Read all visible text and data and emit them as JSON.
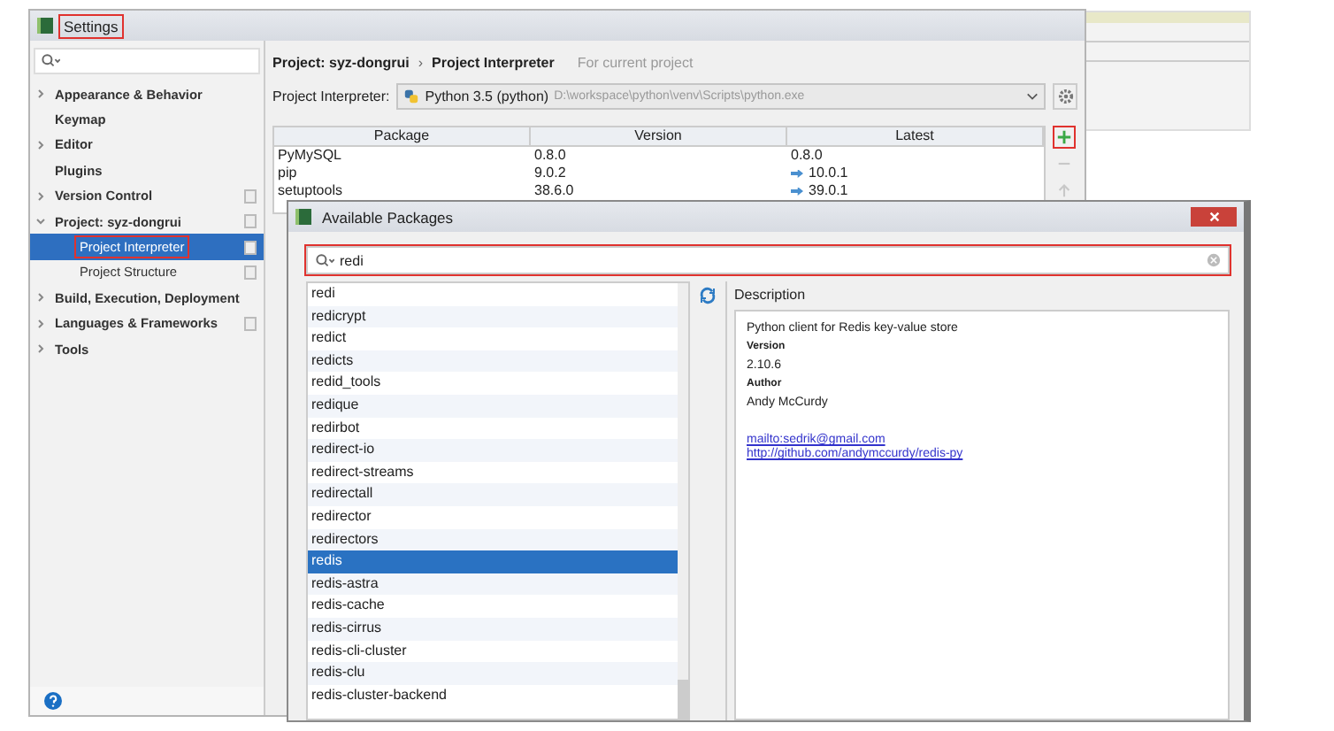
{
  "settings_window": {
    "title": "Settings",
    "title_highlighted": true
  },
  "sidebar": {
    "items": [
      {
        "label": "Appearance & Behavior",
        "expanded": false,
        "selected": false,
        "highlighted": false,
        "badge": false
      },
      {
        "label": "Keymap",
        "selected": false,
        "highlighted": false,
        "badge": false
      },
      {
        "label": "Editor",
        "expanded": false,
        "selected": false,
        "highlighted": false,
        "badge": false
      },
      {
        "label": "Plugins",
        "selected": false,
        "highlighted": false,
        "badge": false
      },
      {
        "label": "Version Control",
        "expanded": false,
        "selected": false,
        "highlighted": false,
        "badge": true
      },
      {
        "label": "Project: syz-dongrui",
        "expanded": true,
        "selected": false,
        "highlighted": false,
        "badge": true,
        "children": [
          {
            "label": "Project Interpreter",
            "selected": true,
            "highlighted": true,
            "badge": true
          },
          {
            "label": "Project Structure",
            "selected": false,
            "highlighted": false,
            "badge": true
          }
        ]
      },
      {
        "label": "Build, Execution, Deployment",
        "expanded": false,
        "selected": false,
        "highlighted": false,
        "badge": false
      },
      {
        "label": "Languages & Frameworks",
        "expanded": false,
        "selected": false,
        "highlighted": false,
        "badge": true
      },
      {
        "label": "Tools",
        "expanded": false,
        "selected": false,
        "highlighted": false,
        "badge": false
      }
    ]
  },
  "breadcrumb": {
    "items": [
      "Project: syz-dongrui",
      "Project Interpreter"
    ],
    "separator": "›",
    "scope_note": "For current project"
  },
  "interpreter": {
    "label": "Project Interpreter:",
    "name": "Python 3.5 (python)",
    "path": "D:\\workspace\\python\\venv\\Scripts\\python.exe"
  },
  "packages_table": {
    "columns": [
      "Package",
      "Version",
      "Latest"
    ],
    "rows": [
      {
        "package": "PyMySQL",
        "version": "0.8.0",
        "latest": "0.8.0",
        "upgrade": false
      },
      {
        "package": "pip",
        "version": "9.0.2",
        "latest": "10.0.1",
        "upgrade": true
      },
      {
        "package": "setuptools",
        "version": "38.6.0",
        "latest": "39.0.1",
        "upgrade": true
      }
    ]
  },
  "table_actions": [
    {
      "kind": "add",
      "disabled": false,
      "highlighted": true
    },
    {
      "kind": "remove",
      "disabled": true,
      "highlighted": false
    },
    {
      "kind": "upgrade",
      "disabled": true,
      "highlighted": false
    }
  ],
  "dialog": {
    "title": "Available Packages",
    "search": {
      "value": "redi",
      "highlighted": true
    },
    "packages": [
      {
        "name": "redi",
        "selected": false
      },
      {
        "name": "redicrypt",
        "selected": false
      },
      {
        "name": "redict",
        "selected": false
      },
      {
        "name": "redicts",
        "selected": false
      },
      {
        "name": "redid_tools",
        "selected": false
      },
      {
        "name": "redique",
        "selected": false
      },
      {
        "name": "redirbot",
        "selected": false
      },
      {
        "name": "redirect-io",
        "selected": false
      },
      {
        "name": "redirect-streams",
        "selected": false
      },
      {
        "name": "redirectall",
        "selected": false
      },
      {
        "name": "redirector",
        "selected": false
      },
      {
        "name": "redirectors",
        "selected": false
      },
      {
        "name": "redis",
        "selected": true
      },
      {
        "name": "redis-astra",
        "selected": false
      },
      {
        "name": "redis-cache",
        "selected": false
      },
      {
        "name": "redis-cirrus",
        "selected": false
      },
      {
        "name": "redis-cli-cluster",
        "selected": false
      },
      {
        "name": "redis-clu",
        "selected": false
      },
      {
        "name": "redis-cluster-backend",
        "selected": false
      }
    ],
    "description": {
      "label": "Description",
      "summary": "Python client for Redis key-value store",
      "fields": [
        {
          "label": "Version",
          "value": "2.10.6"
        },
        {
          "label": "Author",
          "value": "Andy McCurdy"
        }
      ],
      "links": [
        "mailto:sedrik@gmail.com",
        "http://github.com/andymccurdy/redis-py"
      ]
    }
  }
}
